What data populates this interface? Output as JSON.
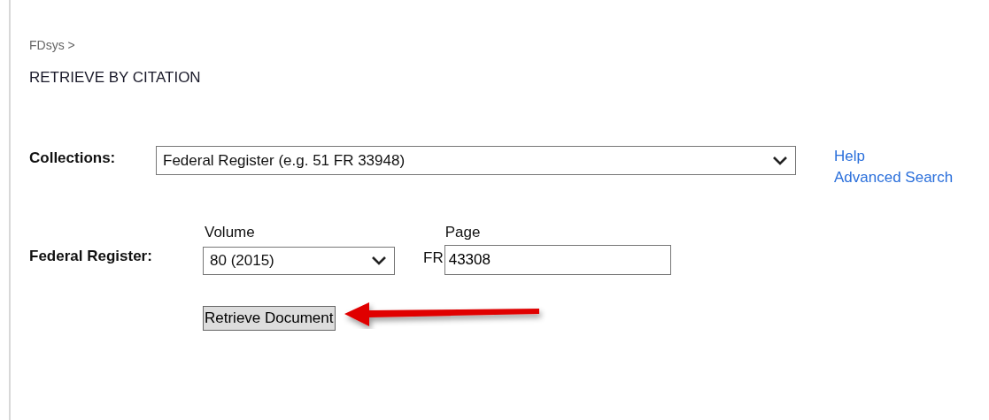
{
  "breadcrumb": "FDsys >",
  "heading": "RETRIEVE BY CITATION",
  "collections": {
    "label": "Collections:",
    "value": "Federal Register (e.g. 51 FR 33948)"
  },
  "links": [
    "Help",
    "Advanced Search"
  ],
  "citation": {
    "label": "Federal Register:",
    "volume_label": "Volume",
    "volume_value": "80 (2015)",
    "page_label": "Page",
    "page_prefix": "FR",
    "page_value": "43308"
  },
  "button": "Retrieve Document"
}
